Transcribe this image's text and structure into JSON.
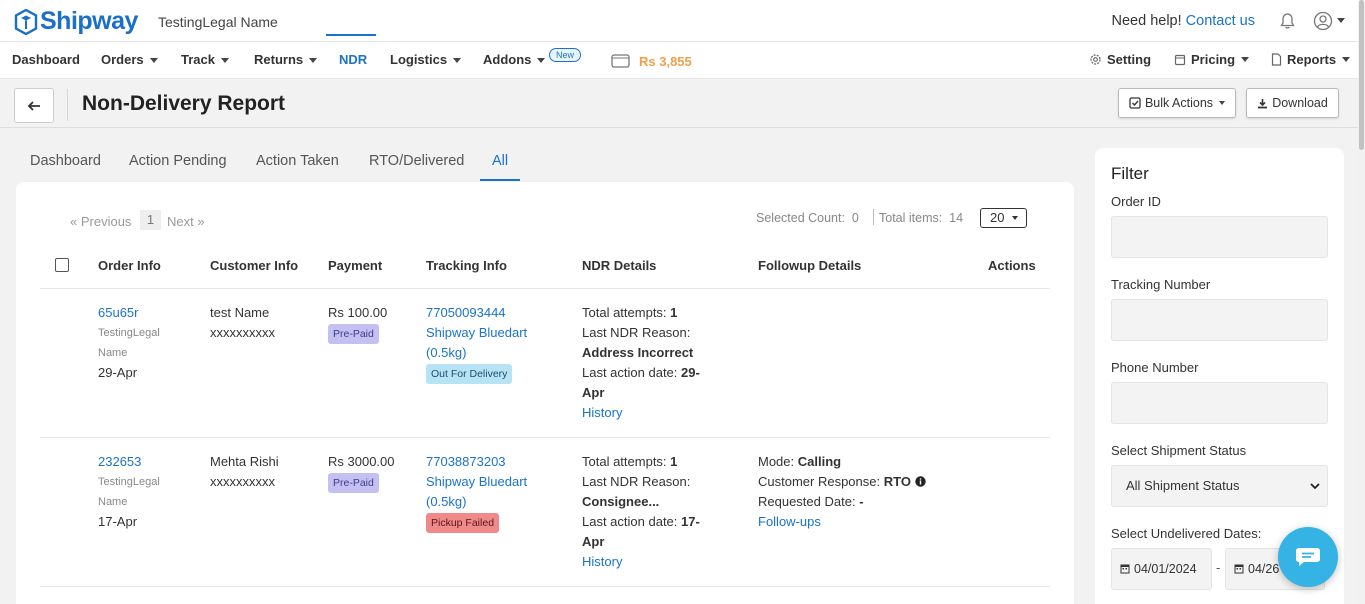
{
  "app": {
    "logo_text": "Shipway",
    "company_name": "TestingLegal Name",
    "help_text": "Need help!",
    "contact_link": "Contact us"
  },
  "nav": {
    "items": [
      {
        "label": "Dashboard"
      },
      {
        "label": "Orders"
      },
      {
        "label": "Track"
      },
      {
        "label": "Returns"
      },
      {
        "label": "NDR"
      },
      {
        "label": "Logistics"
      },
      {
        "label": "Addons"
      }
    ],
    "new_badge": "New",
    "wallet_amount": "Rs 3,855",
    "right": {
      "setting": "Setting",
      "pricing": "Pricing",
      "reports": "Reports"
    }
  },
  "page": {
    "title": "Non-Delivery Report",
    "bulk_actions": "Bulk Actions",
    "download": "Download"
  },
  "tabs": [
    {
      "label": "Dashboard"
    },
    {
      "label": "Action Pending"
    },
    {
      "label": "Action Taken"
    },
    {
      "label": "RTO/Delivered"
    },
    {
      "label": "All"
    }
  ],
  "pagination": {
    "previous": "« Previous",
    "current": "1",
    "next": "Next »",
    "selected_label": "Selected Count:",
    "selected_value": "0",
    "total_label": "Total items:",
    "total_value": "14",
    "per_page": "20"
  },
  "table": {
    "headers": {
      "order": "Order Info",
      "customer": "Customer Info",
      "payment": "Payment",
      "tracking": "Tracking Info",
      "ndr": "NDR Details",
      "followup": "Followup Details",
      "actions": "Actions"
    },
    "rows": [
      {
        "order_id": "65u65r",
        "company_line1": "TestingLegal",
        "company_line2": "Name",
        "order_date": "29-Apr",
        "customer_name": "test Name",
        "customer_phone": "xxxxxxxxxx",
        "payment_amount": "Rs 100.00",
        "payment_badge": "Pre-Paid",
        "tracking_number": "77050093444",
        "courier_line1": "Shipway Bluedart",
        "courier_line2": "(0.5kg)",
        "status_badge": "Out For Delivery",
        "attempts_label": "Total attempts:",
        "attempts_value": "1",
        "reason_label": "Last NDR Reason:",
        "reason_value": "Address Incorrect",
        "action_date_label": "Last action date:",
        "action_date_value1": "29-",
        "action_date_value2": "Apr",
        "history_link": "History"
      },
      {
        "order_id": "232653",
        "company_line1": "TestingLegal",
        "company_line2": "Name",
        "order_date": "17-Apr",
        "customer_name": "Mehta Rishi",
        "customer_phone": "xxxxxxxxxx",
        "payment_amount": "Rs 3000.00",
        "payment_badge": "Pre-Paid",
        "tracking_number": "77038873203",
        "courier_line1": "Shipway Bluedart",
        "courier_line2": "(0.5kg)",
        "status_badge": "Pickup Failed",
        "attempts_label": "Total attempts:",
        "attempts_value": "1",
        "reason_label": "Last NDR Reason:",
        "reason_value": "Consignee...",
        "action_date_label": "Last action date:",
        "action_date_value1": "17-",
        "action_date_value2": "Apr",
        "history_link": "History",
        "mode_label": "Mode:",
        "mode_value": "Calling",
        "response_label": "Customer Response:",
        "response_value": "RTO",
        "requested_label": "Requested Date:",
        "requested_value": "-",
        "followups_link": "Follow-ups"
      }
    ]
  },
  "filter": {
    "title": "Filter",
    "order_id_label": "Order ID",
    "tracking_label": "Tracking Number",
    "phone_label": "Phone Number",
    "status_label": "Select Shipment Status",
    "status_value": "All Shipment Status",
    "dates_label": "Select Undelivered Dates:",
    "date_from": "04/01/2024",
    "date_separator": "-",
    "date_to": "04/26"
  },
  "colors": {
    "brand": "#1a6fc9",
    "link": "#1a73c9",
    "wallet": "#f0a04b",
    "chat": "#34b3e4"
  },
  "icons": [
    "back-arrow-icon",
    "bell-icon",
    "user-icon",
    "wallet-icon",
    "gear-icon",
    "pricing-icon",
    "reports-icon",
    "check-square-icon",
    "download-icon",
    "calendar-icon",
    "info-icon",
    "chat-icon"
  ]
}
